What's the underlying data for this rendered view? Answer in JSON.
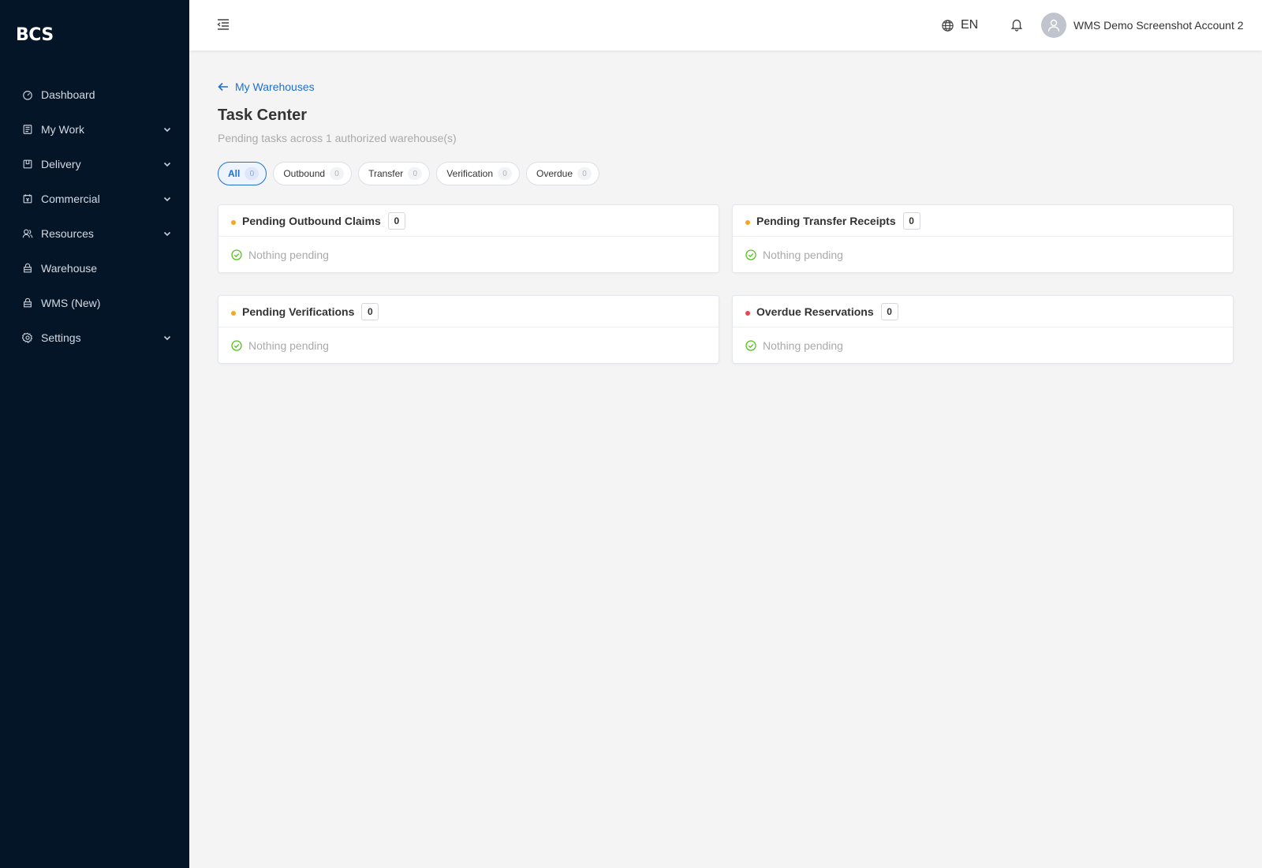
{
  "brand": "BCS",
  "sidebar": {
    "items": [
      {
        "label": "Dashboard",
        "icon": "dashboard-icon",
        "expandable": false
      },
      {
        "label": "My Work",
        "icon": "document-icon",
        "expandable": true
      },
      {
        "label": "Delivery",
        "icon": "delivery-icon",
        "expandable": true
      },
      {
        "label": "Commercial",
        "icon": "commercial-icon",
        "expandable": true
      },
      {
        "label": "Resources",
        "icon": "users-icon",
        "expandable": true
      },
      {
        "label": "Warehouse",
        "icon": "warehouse-icon",
        "expandable": false
      },
      {
        "label": "WMS (New)",
        "icon": "warehouse-icon",
        "expandable": false
      },
      {
        "label": "Settings",
        "icon": "gear-icon",
        "expandable": true
      }
    ]
  },
  "header": {
    "language": "EN",
    "user_name": "WMS Demo Screenshot Account 2"
  },
  "main": {
    "back_label": "My Warehouses",
    "title": "Task Center",
    "subtitle": "Pending tasks across 1 authorized warehouse(s)",
    "filters": [
      {
        "label": "All",
        "count": "0",
        "active": true
      },
      {
        "label": "Outbound",
        "count": "0",
        "active": false
      },
      {
        "label": "Transfer",
        "count": "0",
        "active": false
      },
      {
        "label": "Verification",
        "count": "0",
        "active": false
      },
      {
        "label": "Overdue",
        "count": "0",
        "active": false
      }
    ],
    "cards": [
      {
        "title": "Pending Outbound Claims",
        "count": "0",
        "dot_color": "#f5a623",
        "empty_text": "Nothing pending"
      },
      {
        "title": "Pending Transfer Receipts",
        "count": "0",
        "dot_color": "#f5a623",
        "empty_text": "Nothing pending"
      },
      {
        "title": "Pending Verifications",
        "count": "0",
        "dot_color": "#f5a623",
        "empty_text": "Nothing pending"
      },
      {
        "title": "Overdue Reservations",
        "count": "0",
        "dot_color": "#f0434e",
        "empty_text": "Nothing pending"
      }
    ]
  },
  "colors": {
    "sidebar_bg": "#041528",
    "accent": "#1f6fd1",
    "success": "#52c41a",
    "warning_dot": "#f5a623",
    "danger_dot": "#f0434e"
  }
}
